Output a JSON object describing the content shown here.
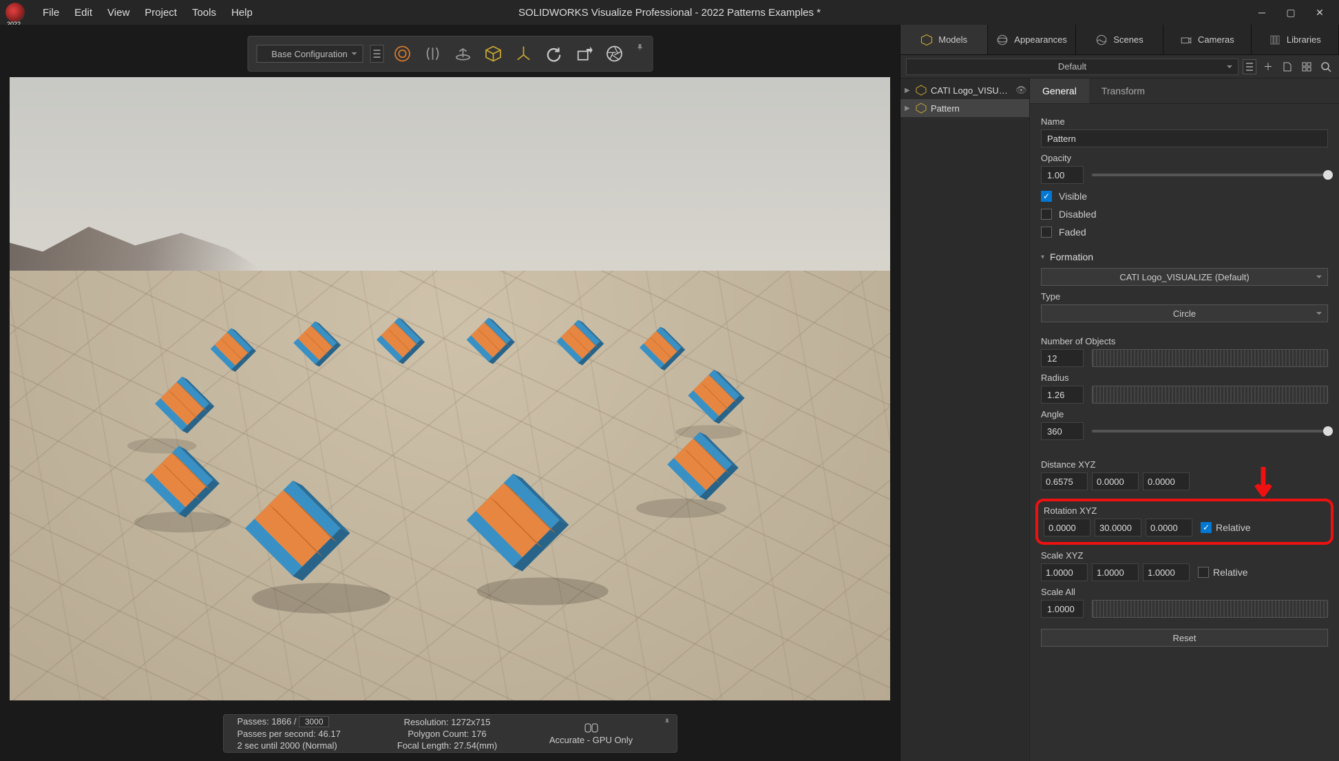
{
  "app": {
    "title": "SOLIDWORKS Visualize Professional - 2022 Patterns Examples *",
    "year": "2022",
    "menus": [
      "File",
      "Edit",
      "View",
      "Project",
      "Tools",
      "Help"
    ]
  },
  "toolbar": {
    "config": "Base Configuration"
  },
  "status": {
    "passes_label": "Passes:",
    "passes_current": "1866",
    "passes_sep": "/",
    "passes_total": "3000",
    "pps": "Passes per second: 46.17",
    "eta": "2 sec until 2000 (Normal)",
    "resolution": "Resolution: 1272x715",
    "polygons": "Polygon Count: 176",
    "focal": "Focal Length: 27.54(mm)",
    "mode": "Accurate - GPU Only"
  },
  "right_tabs": {
    "models": "Models",
    "appearances": "Appearances",
    "scenes": "Scenes",
    "cameras": "Cameras",
    "libraries": "Libraries"
  },
  "sub": {
    "default": "Default"
  },
  "tree": {
    "item1": "CATI Logo_VISUAL...",
    "item2": "Pattern"
  },
  "prop_tabs": {
    "general": "General",
    "transform": "Transform"
  },
  "props": {
    "name_label": "Name",
    "name_value": "Pattern",
    "opacity_label": "Opacity",
    "opacity_value": "1.00",
    "visible": "Visible",
    "disabled": "Disabled",
    "faded": "Faded",
    "formation_hdr": "Formation",
    "formation_value": "CATI Logo_VISUALIZE (Default)",
    "type_label": "Type",
    "type_value": "Circle",
    "numobj_label": "Number of Objects",
    "numobj_value": "12",
    "radius_label": "Radius",
    "radius_value": "1.26",
    "angle_label": "Angle",
    "angle_value": "360",
    "distance_label": "Distance XYZ",
    "distance": {
      "x": "0.6575",
      "y": "0.0000",
      "z": "0.0000"
    },
    "rotation_label": "Rotation XYZ",
    "rotation": {
      "x": "0.0000",
      "y": "30.0000",
      "z": "0.0000"
    },
    "relative": "Relative",
    "scale_label": "Scale XYZ",
    "scale": {
      "x": "1.0000",
      "y": "1.0000",
      "z": "1.0000"
    },
    "scaleall_label": "Scale All",
    "scaleall_value": "1.0000",
    "reset": "Reset"
  }
}
